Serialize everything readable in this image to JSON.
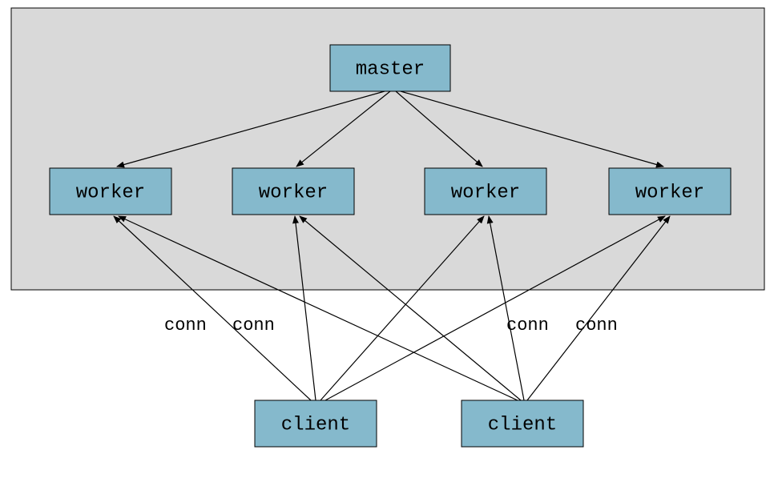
{
  "diagram": {
    "master": {
      "label": "master"
    },
    "workers": [
      {
        "label": "worker"
      },
      {
        "label": "worker"
      },
      {
        "label": "worker"
      },
      {
        "label": "worker"
      }
    ],
    "clients": [
      {
        "label": "client"
      },
      {
        "label": "client"
      }
    ],
    "edge_labels": [
      {
        "text": "conn"
      },
      {
        "text": "conn"
      },
      {
        "text": "conn"
      },
      {
        "text": "conn"
      }
    ]
  }
}
